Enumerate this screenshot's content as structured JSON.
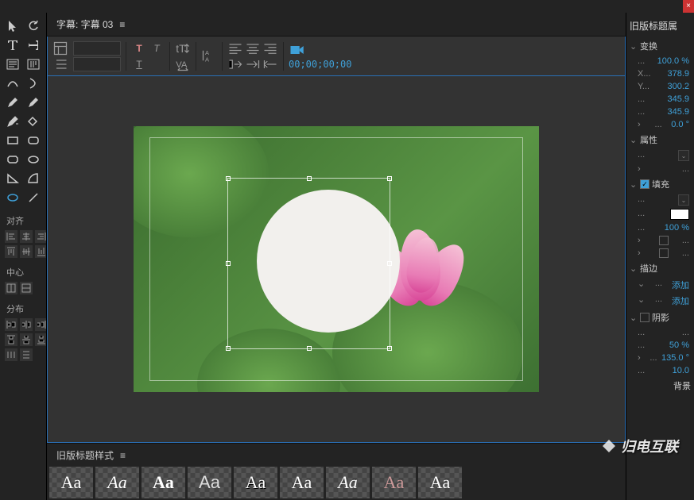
{
  "titlebar": {
    "close": "×"
  },
  "subtitle_header": {
    "label": "字幕: 字幕 03",
    "menu": "≡"
  },
  "toolbar": {
    "timecode": "00;00;00;00"
  },
  "left": {
    "align_label": "对齐",
    "center_label": "中心",
    "distribute_label": "分布"
  },
  "styles": {
    "header": "旧版标题样式",
    "menu": "≡",
    "thumb_text": "Aa"
  },
  "right": {
    "header": "旧版标题属",
    "transform": {
      "label": "变换",
      "pct": "100.0 %",
      "x_label": "X...",
      "x": "378.9",
      "y_label": "Y...",
      "y": "300.2",
      "w": "345.9",
      "h": "345.9",
      "rot": "0.0 °"
    },
    "props": {
      "label": "属性",
      "dots": "..."
    },
    "fill": {
      "label": "填充",
      "pct": "100 %"
    },
    "stroke": {
      "label": "描边",
      "add": "添加"
    },
    "shadow": {
      "label": "阴影",
      "dots": "...",
      "pct": "50 %",
      "angle": "135.0 °",
      "dist": "10.0"
    },
    "bg": {
      "label": "背景"
    }
  },
  "watermark": "归电互联"
}
